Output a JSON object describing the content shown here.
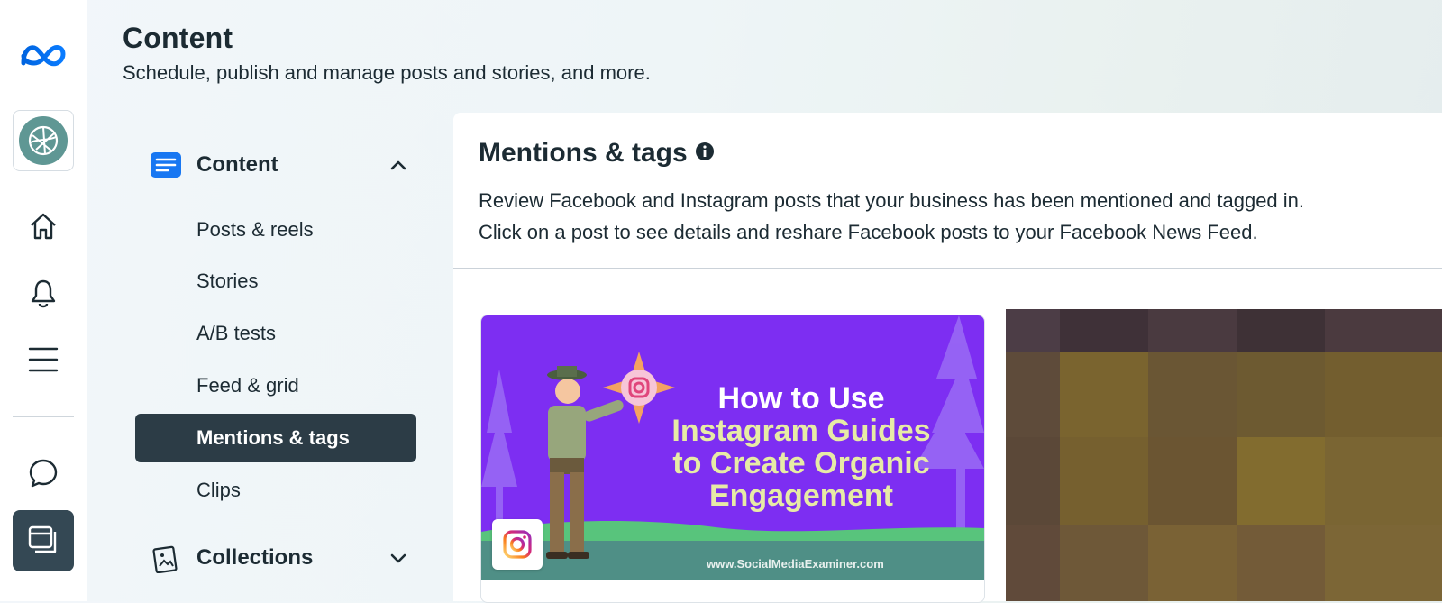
{
  "header": {
    "title": "Content",
    "subtitle": "Schedule, publish and manage posts and stories, and more."
  },
  "rail": {
    "items": [
      "meta-logo-icon",
      "page-avatar",
      "home-icon",
      "bell-icon",
      "menu-icon",
      "chat-icon",
      "content-icon"
    ]
  },
  "nav": {
    "content_section": "Content",
    "items": [
      {
        "label": "Posts & reels"
      },
      {
        "label": "Stories"
      },
      {
        "label": "A/B tests"
      },
      {
        "label": "Feed & grid"
      },
      {
        "label": "Mentions & tags",
        "active": true
      },
      {
        "label": "Clips"
      }
    ],
    "collections_section": "Collections"
  },
  "main": {
    "title": "Mentions & tags",
    "description_line1": "Review Facebook and Instagram posts that your business has been mentioned and tagged in.",
    "description_line2": "Click on a post to see details and reshare Facebook posts to your Facebook News Feed."
  },
  "post": {
    "headline_line1": "How to Use",
    "headline_line2": "Instagram Guides",
    "headline_line3": "to Create Organic",
    "headline_line4": "Engagement",
    "url": "www.SocialMediaExaminer.com",
    "platform_icon": "instagram-icon"
  },
  "colors": {
    "accent_blue": "#1877f2",
    "active_nav_bg": "#2c3c46",
    "rail_active_bg": "#344854",
    "post_purple": "#7d2ef2"
  }
}
